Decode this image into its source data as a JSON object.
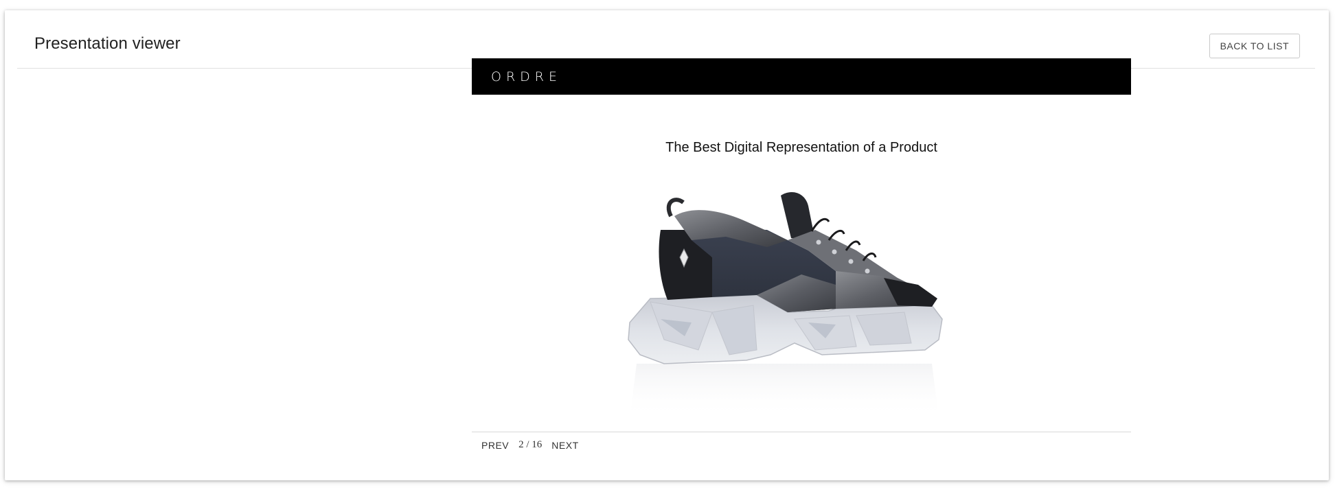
{
  "header": {
    "title": "Presentation viewer",
    "back_label": "BACK TO LIST"
  },
  "slide": {
    "brand": "ORDRE",
    "heading": "The Best Digital Representation of a Product",
    "image_icon": "sneaker-product-image",
    "colors": {
      "header_bg": "#000000",
      "brand_text": "#ffffff",
      "heading_text": "#111111"
    }
  },
  "pager": {
    "prev_label": "PREV",
    "current_page": "2",
    "separator": "/",
    "total_pages": "16",
    "next_label": "NEXT"
  }
}
